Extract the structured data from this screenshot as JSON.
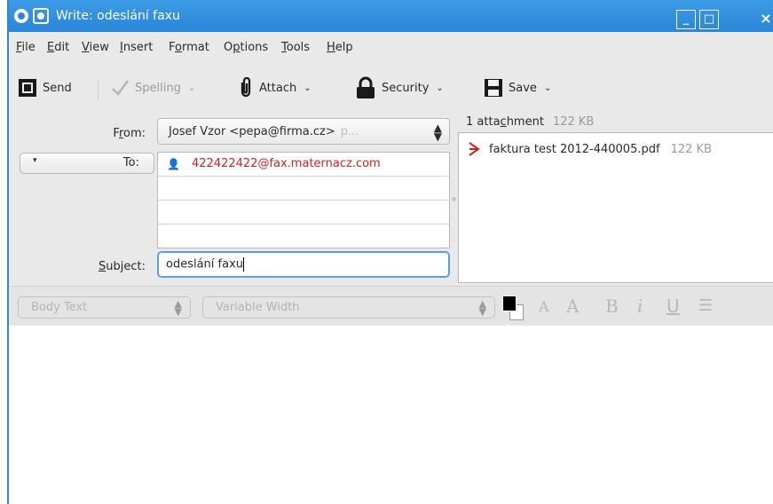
{
  "window": {
    "title": "Write: odeslání faxu",
    "controls": {
      "minimize": "_",
      "maximize": "□",
      "close": "×"
    }
  },
  "menu": [
    {
      "label_underlined": "F",
      "label_rest": "ile"
    },
    {
      "label_underlined": "E",
      "label_rest": "dit"
    },
    {
      "label_underlined": "V",
      "label_rest": "iew"
    },
    {
      "label_underlined": "I",
      "label_rest": "nsert"
    },
    {
      "label_pre": "F",
      "label_underlined": "o",
      "label_rest": "rmat"
    },
    {
      "label_pre": "O",
      "label_underlined": "p",
      "label_rest": "tions"
    },
    {
      "label_underlined": "T",
      "label_rest": "ools"
    },
    {
      "label_underlined": "H",
      "label_rest": "elp"
    }
  ],
  "toolbar": {
    "send": {
      "label": "Send",
      "icon": "send-icon"
    },
    "spelling": {
      "label": "Spelling",
      "icon": "checkmark-icon",
      "chevron": "⌄"
    },
    "attach": {
      "label": "Attach",
      "icon": "paperclip-icon",
      "chevron": "⌄"
    },
    "security": {
      "label": "Security",
      "icon": "lock-icon",
      "chevron": "⌄"
    },
    "save": {
      "label": "Save",
      "icon": "floppy-disk-icon",
      "chevron": "⌄"
    }
  },
  "header": {
    "from_label_pre": "F",
    "from_label_underlined": "r",
    "from_label_rest": "om:",
    "from_value": "Josef Vzor <pepa@firma.cz>",
    "from_hint": "p...",
    "to_label": "To:",
    "recipients": [
      "422422422@fax.maternacz.com",
      "",
      "",
      ""
    ],
    "subject_label_underlined": "S",
    "subject_label_rest": "ubject:",
    "subject_value": "odeslání faxu"
  },
  "attachments": {
    "header_pre": "1 atta",
    "header_underlined": "c",
    "header_rest": "hment",
    "total_size": "122 KB",
    "items": [
      {
        "name": "faktura test 2012-440005.pdf",
        "size": "122 KB",
        "icon": "pdf-icon"
      }
    ]
  },
  "format_toolbar": {
    "paragraph_style": "Body Text",
    "font": "Variable Width",
    "text_color": "#000000",
    "background_color": "#ffffff",
    "buttons": [
      "smaller-text-icon",
      "larger-text-icon",
      "bold-icon",
      "italic-icon",
      "underline-icon",
      "bullet-list-icon"
    ]
  },
  "colors": {
    "titlebar": "#2f87d6",
    "recipient_text": "#d42020",
    "focus_border": "#5aa0e6"
  }
}
